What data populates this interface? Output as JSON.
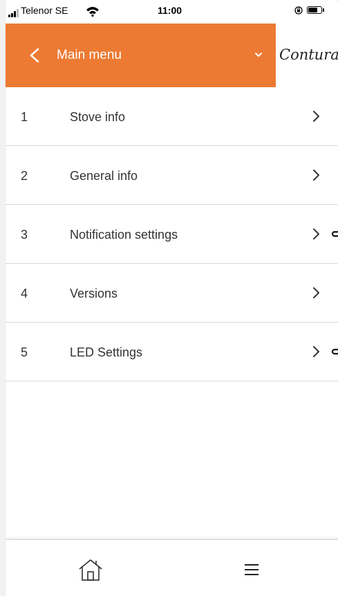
{
  "status_bar": {
    "carrier": "Telenor SE",
    "time": "11:00",
    "icons": [
      "signal-icon",
      "wifi-icon",
      "rotation-lock-icon",
      "battery-icon"
    ]
  },
  "header": {
    "back_icon": "chevron-left-icon",
    "title": "Main menu",
    "dropdown_icon": "chevron-down-icon",
    "logo_text": "Contura",
    "accent_color": "#ec7a33"
  },
  "menu": {
    "items": [
      {
        "number": "1",
        "label": "Stove info",
        "icon": "chevron-right-icon",
        "has_toggle_edge": false
      },
      {
        "number": "2",
        "label": "General info",
        "icon": "chevron-right-icon",
        "has_toggle_edge": false
      },
      {
        "number": "3",
        "label": "Notification settings",
        "icon": "chevron-right-icon",
        "has_toggle_edge": true
      },
      {
        "number": "4",
        "label": "Versions",
        "icon": "chevron-right-icon",
        "has_toggle_edge": false
      },
      {
        "number": "5",
        "label": "LED Settings",
        "icon": "chevron-right-icon",
        "has_toggle_edge": true
      }
    ]
  },
  "bottom_nav": {
    "items": [
      "home-icon",
      "hamburger-menu-icon"
    ]
  }
}
